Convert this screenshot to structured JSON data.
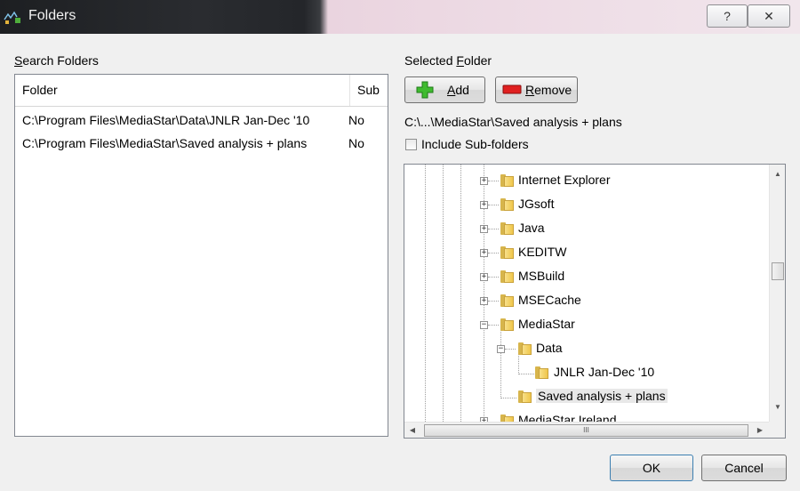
{
  "window": {
    "title": "Folders",
    "help_label": "?",
    "close_label": "✕"
  },
  "search_folders": {
    "label_prefix": "",
    "label_underlined": "S",
    "label_rest": "earch Folders",
    "columns": [
      "Folder",
      "Sub"
    ],
    "rows": [
      {
        "folder": "C:\\Program Files\\MediaStar\\Data\\JNLR Jan-Dec '10",
        "sub": "No"
      },
      {
        "folder": "C:\\Program Files\\MediaStar\\Saved analysis + plans",
        "sub": "No"
      }
    ]
  },
  "selected_folder": {
    "label_prefix": "Selected ",
    "label_underlined": "F",
    "label_rest": "older",
    "add_underlined": "A",
    "add_rest": "dd",
    "remove_underlined": "R",
    "remove_rest": "emove",
    "path": "C:\\...\\MediaStar\\Saved analysis + plans",
    "include_subfolders_label": "Include Sub-folders",
    "include_subfolders_checked": false
  },
  "tree": {
    "items": [
      {
        "label": "Internet Explorer",
        "expander": "+"
      },
      {
        "label": "JGsoft",
        "expander": "+"
      },
      {
        "label": "Java",
        "expander": "+"
      },
      {
        "label": "KEDITW",
        "expander": "+"
      },
      {
        "label": "MSBuild",
        "expander": "+"
      },
      {
        "label": "MSECache",
        "expander": "+"
      },
      {
        "label": "MediaStar",
        "expander": "−"
      },
      {
        "label": "Data",
        "expander": "−"
      },
      {
        "label": "JNLR Jan-Dec '10",
        "expander": ""
      },
      {
        "label": "Saved analysis + plans",
        "expander": ""
      },
      {
        "label": "MediaStar Ireland",
        "expander": "+"
      }
    ],
    "hscroll_grip": "III"
  },
  "footer": {
    "ok_label": "OK",
    "cancel_label": "Cancel"
  }
}
